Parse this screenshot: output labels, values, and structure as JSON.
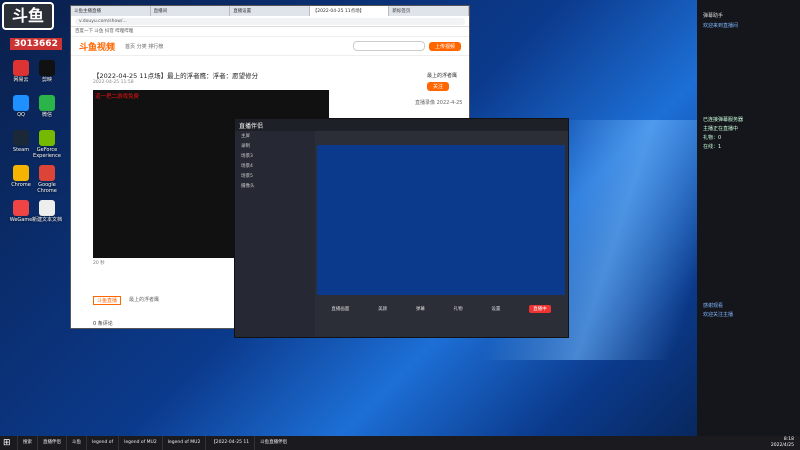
{
  "corner_logo": "斗鱼",
  "room": {
    "id": "3013662"
  },
  "desktop_icons": [
    {
      "label": "网易云",
      "color": "#d33"
    },
    {
      "label": "剪映",
      "color": "#111"
    },
    {
      "label": "QQ",
      "color": "#1e90ff"
    },
    {
      "label": "微信",
      "color": "#2bb44a"
    },
    {
      "label": "Steam",
      "color": "#1b2838"
    },
    {
      "label": "GeForce Experience",
      "color": "#76b900"
    },
    {
      "label": "Chrome",
      "color": "#f4b400"
    },
    {
      "label": "Google Chrome",
      "color": "#db4437"
    },
    {
      "label": "WeGame",
      "color": "#e44"
    },
    {
      "label": "新建文本文档",
      "color": "#eee"
    }
  ],
  "browser": {
    "tabs": [
      "斗鱼主播直播",
      "直播间",
      "直播设置",
      "【2022-04-25 11点场】",
      "新标签页"
    ],
    "address": "v.douyu.com/show/...",
    "bookmarks": "百度一下  斗鱼  抖音  哔哩哔哩",
    "site_logo": "斗鱼视频",
    "site_nav": "首页  分类  排行榜",
    "upload_label": "上传视频",
    "video_title": "【2022-04-25 11点场】最上的浮者鹰：浮者：愿望修分",
    "video_meta": "2022-04-25 11:58",
    "video_overlay": "道一把二游戏免费",
    "player_count": "20 秒",
    "tag_primary": "斗鱼直播",
    "tag_secondary": "最上的浮者鹰",
    "comments_label": "0 条评论",
    "uploader_name": "最上的浮者鹰",
    "follow_label": "关注",
    "side_date": "直播录像 2022-4-25"
  },
  "obs": {
    "title": "直播伴侣",
    "scene_rows": [
      "主屏",
      "录制",
      "场景3",
      "场景4",
      "场景5",
      "摄像头"
    ],
    "tools": [
      "直播画面",
      "美颜",
      "弹幕",
      "礼物",
      "设置"
    ],
    "record_label": "直播中"
  },
  "right_panel": {
    "title": "弹幕助手",
    "lines_top": [
      "欢迎来到直播间"
    ],
    "lines_mid": [
      "已连接弹幕服务器",
      "主播正在直播中",
      "礼物：0",
      "在线：1"
    ],
    "lines_bottom": [
      "感谢观看",
      "欢迎关注主播"
    ]
  },
  "taskbar": {
    "items": [
      "搜索",
      "直播伴侣",
      "斗鱼",
      "legend of",
      "legend of MU2",
      "legend of MU2",
      "【2022-04-25 11",
      "斗鱼直播伴侣"
    ],
    "time": "8:18",
    "date": "2022/4/25"
  }
}
